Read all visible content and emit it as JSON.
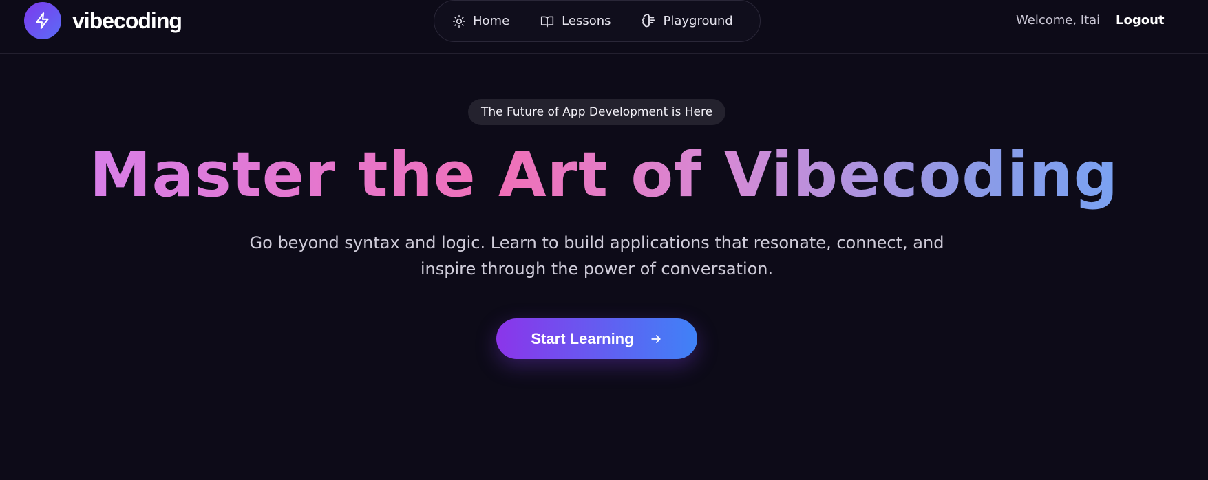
{
  "header": {
    "brand_name": "vibecoding",
    "logo_icon": "lightning-bolt-icon",
    "nav": [
      {
        "label": "Home",
        "icon": "sun-icon"
      },
      {
        "label": "Lessons",
        "icon": "book-open-icon"
      },
      {
        "label": "Playground",
        "icon": "brain-icon"
      }
    ],
    "welcome_text": "Welcome, Itai",
    "logout_label": "Logout"
  },
  "hero": {
    "badge": "The Future of App Development is Here",
    "headline": "Master the Art of Vibecoding",
    "subtitle_line1": "Go beyond syntax and logic. Learn to build applications that resonate, connect, and",
    "subtitle_line2": "inspire through the power of conversation.",
    "cta_label": "Start Learning",
    "cta_icon": "arrow-right-icon"
  },
  "colors": {
    "background": "#0d0b18",
    "accent_purple": "#8b35ea",
    "accent_blue": "#3f82f7",
    "headline_pink": "#f070b8"
  }
}
